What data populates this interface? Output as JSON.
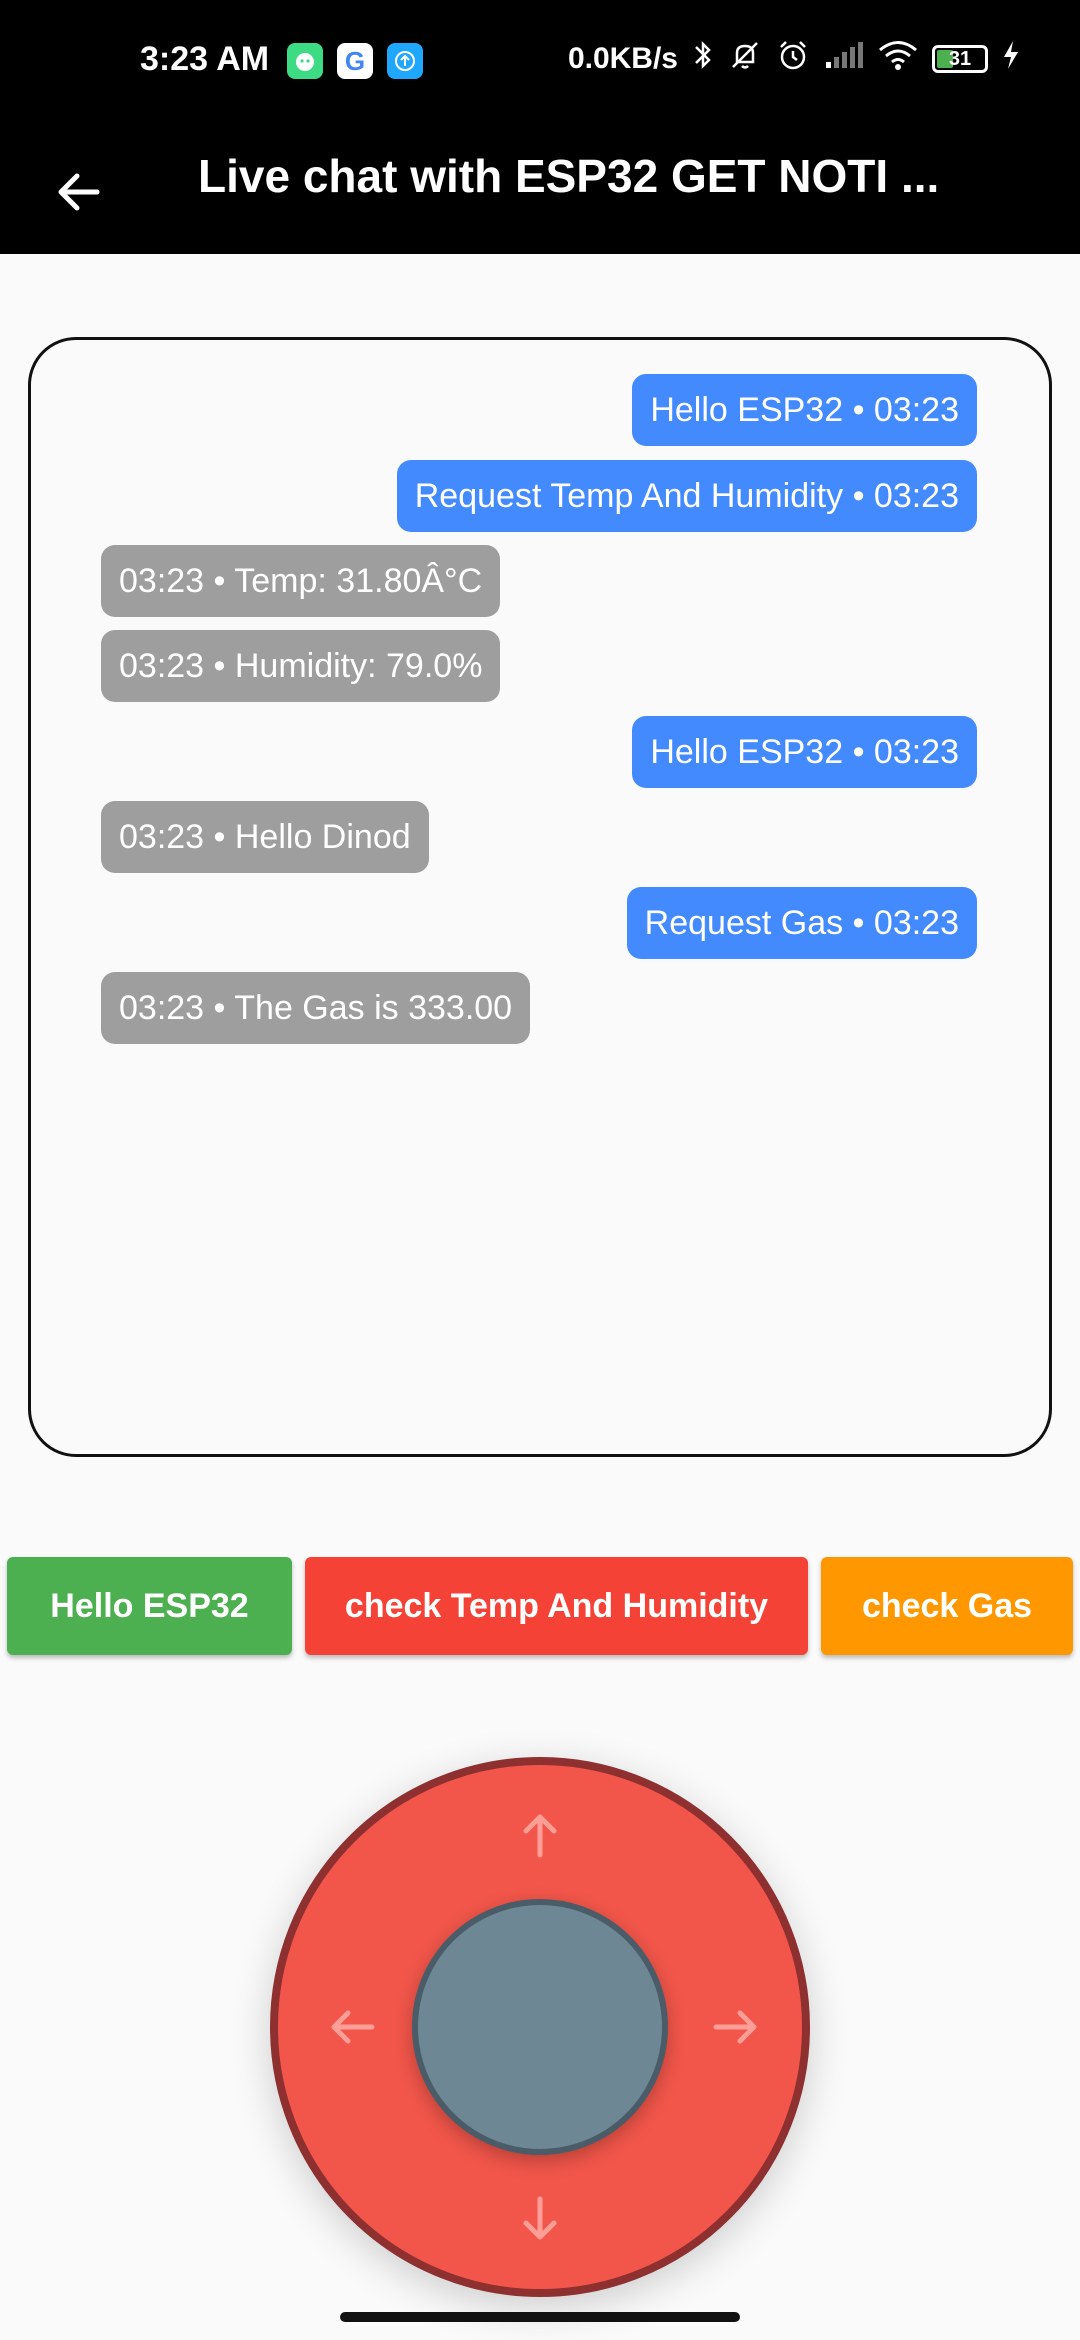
{
  "status_bar": {
    "time": "3:23 AM",
    "network_speed": "0.0KB/s",
    "battery_level": "31",
    "notification_icons": [
      "android-icon",
      "google-icon",
      "upload-icon"
    ],
    "system_icons": [
      "bluetooth-icon",
      "mute-icon",
      "alarm-icon",
      "signal-icon",
      "wifi-icon",
      "battery-icon",
      "charging-icon"
    ]
  },
  "app_bar": {
    "title": "Live chat with ESP32 GET NOTI ..."
  },
  "chat": {
    "messages": [
      {
        "direction": "sent",
        "text": "Hello ESP32 • 03:23"
      },
      {
        "direction": "sent",
        "text": "Request Temp And Humidity • 03:23"
      },
      {
        "direction": "received",
        "text": "03:23 • Temp: 31.80Â°C"
      },
      {
        "direction": "received",
        "text": "03:23 • Humidity: 79.0%"
      },
      {
        "direction": "sent",
        "text": "Hello ESP32 • 03:23"
      },
      {
        "direction": "received",
        "text": "03:23 • Hello Dinod"
      },
      {
        "direction": "sent",
        "text": "Request Gas • 03:23"
      },
      {
        "direction": "received",
        "text": "03:23 • The Gas is 333.00"
      }
    ]
  },
  "actions": {
    "hello_label": "Hello ESP32",
    "temp_label": "check Temp And Humidity",
    "gas_label": "check Gas"
  },
  "colors": {
    "sent_bubble": "#448aff",
    "received_bubble": "#9e9e9e",
    "hello_button": "#4caf50",
    "temp_button": "#f44336",
    "gas_button": "#ff9800",
    "joystick_base": "#f2564a",
    "joystick_knob": "#6e8795"
  },
  "joystick": {
    "icons": [
      "arrow-up-icon",
      "arrow-left-icon",
      "arrow-right-icon",
      "arrow-down-icon"
    ]
  }
}
